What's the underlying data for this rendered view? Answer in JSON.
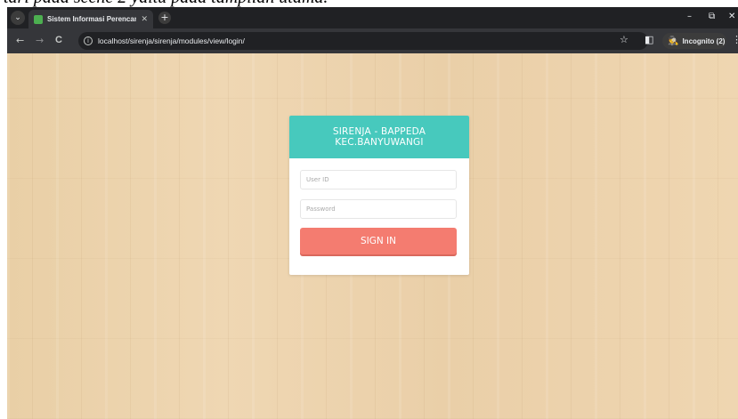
{
  "caption": "tari pada scene 2 yaitu pada tampilan utama.",
  "browser": {
    "tab_search_glyph": "⌄",
    "tab_title": "Sistem Informasi Perencanaan",
    "tab_close": "✕",
    "new_tab": "+",
    "window_controls": {
      "minimize": "–",
      "restore": "⧉",
      "close": "✕"
    },
    "nav": {
      "back": "←",
      "forward": "→",
      "reload": "C"
    },
    "info_glyph": "i",
    "url": "localhost/sirenja/sirenja/modules/view/login/",
    "star": "☆",
    "sidepanel": "◧",
    "incognito_glyph": "🕵",
    "incognito_label": "Incognito (2)",
    "menu": "⋮"
  },
  "login": {
    "header_line1": "SIRENJA - BAPPEDA",
    "header_line2": "KEC.BANYUWANGI",
    "userid_placeholder": "User ID",
    "password_placeholder": "Password",
    "signin_label": "SIGN IN"
  },
  "colors": {
    "header_teal": "#47c9bd",
    "signin_salmon": "#f47c70",
    "wood": "#ecd2ab"
  }
}
